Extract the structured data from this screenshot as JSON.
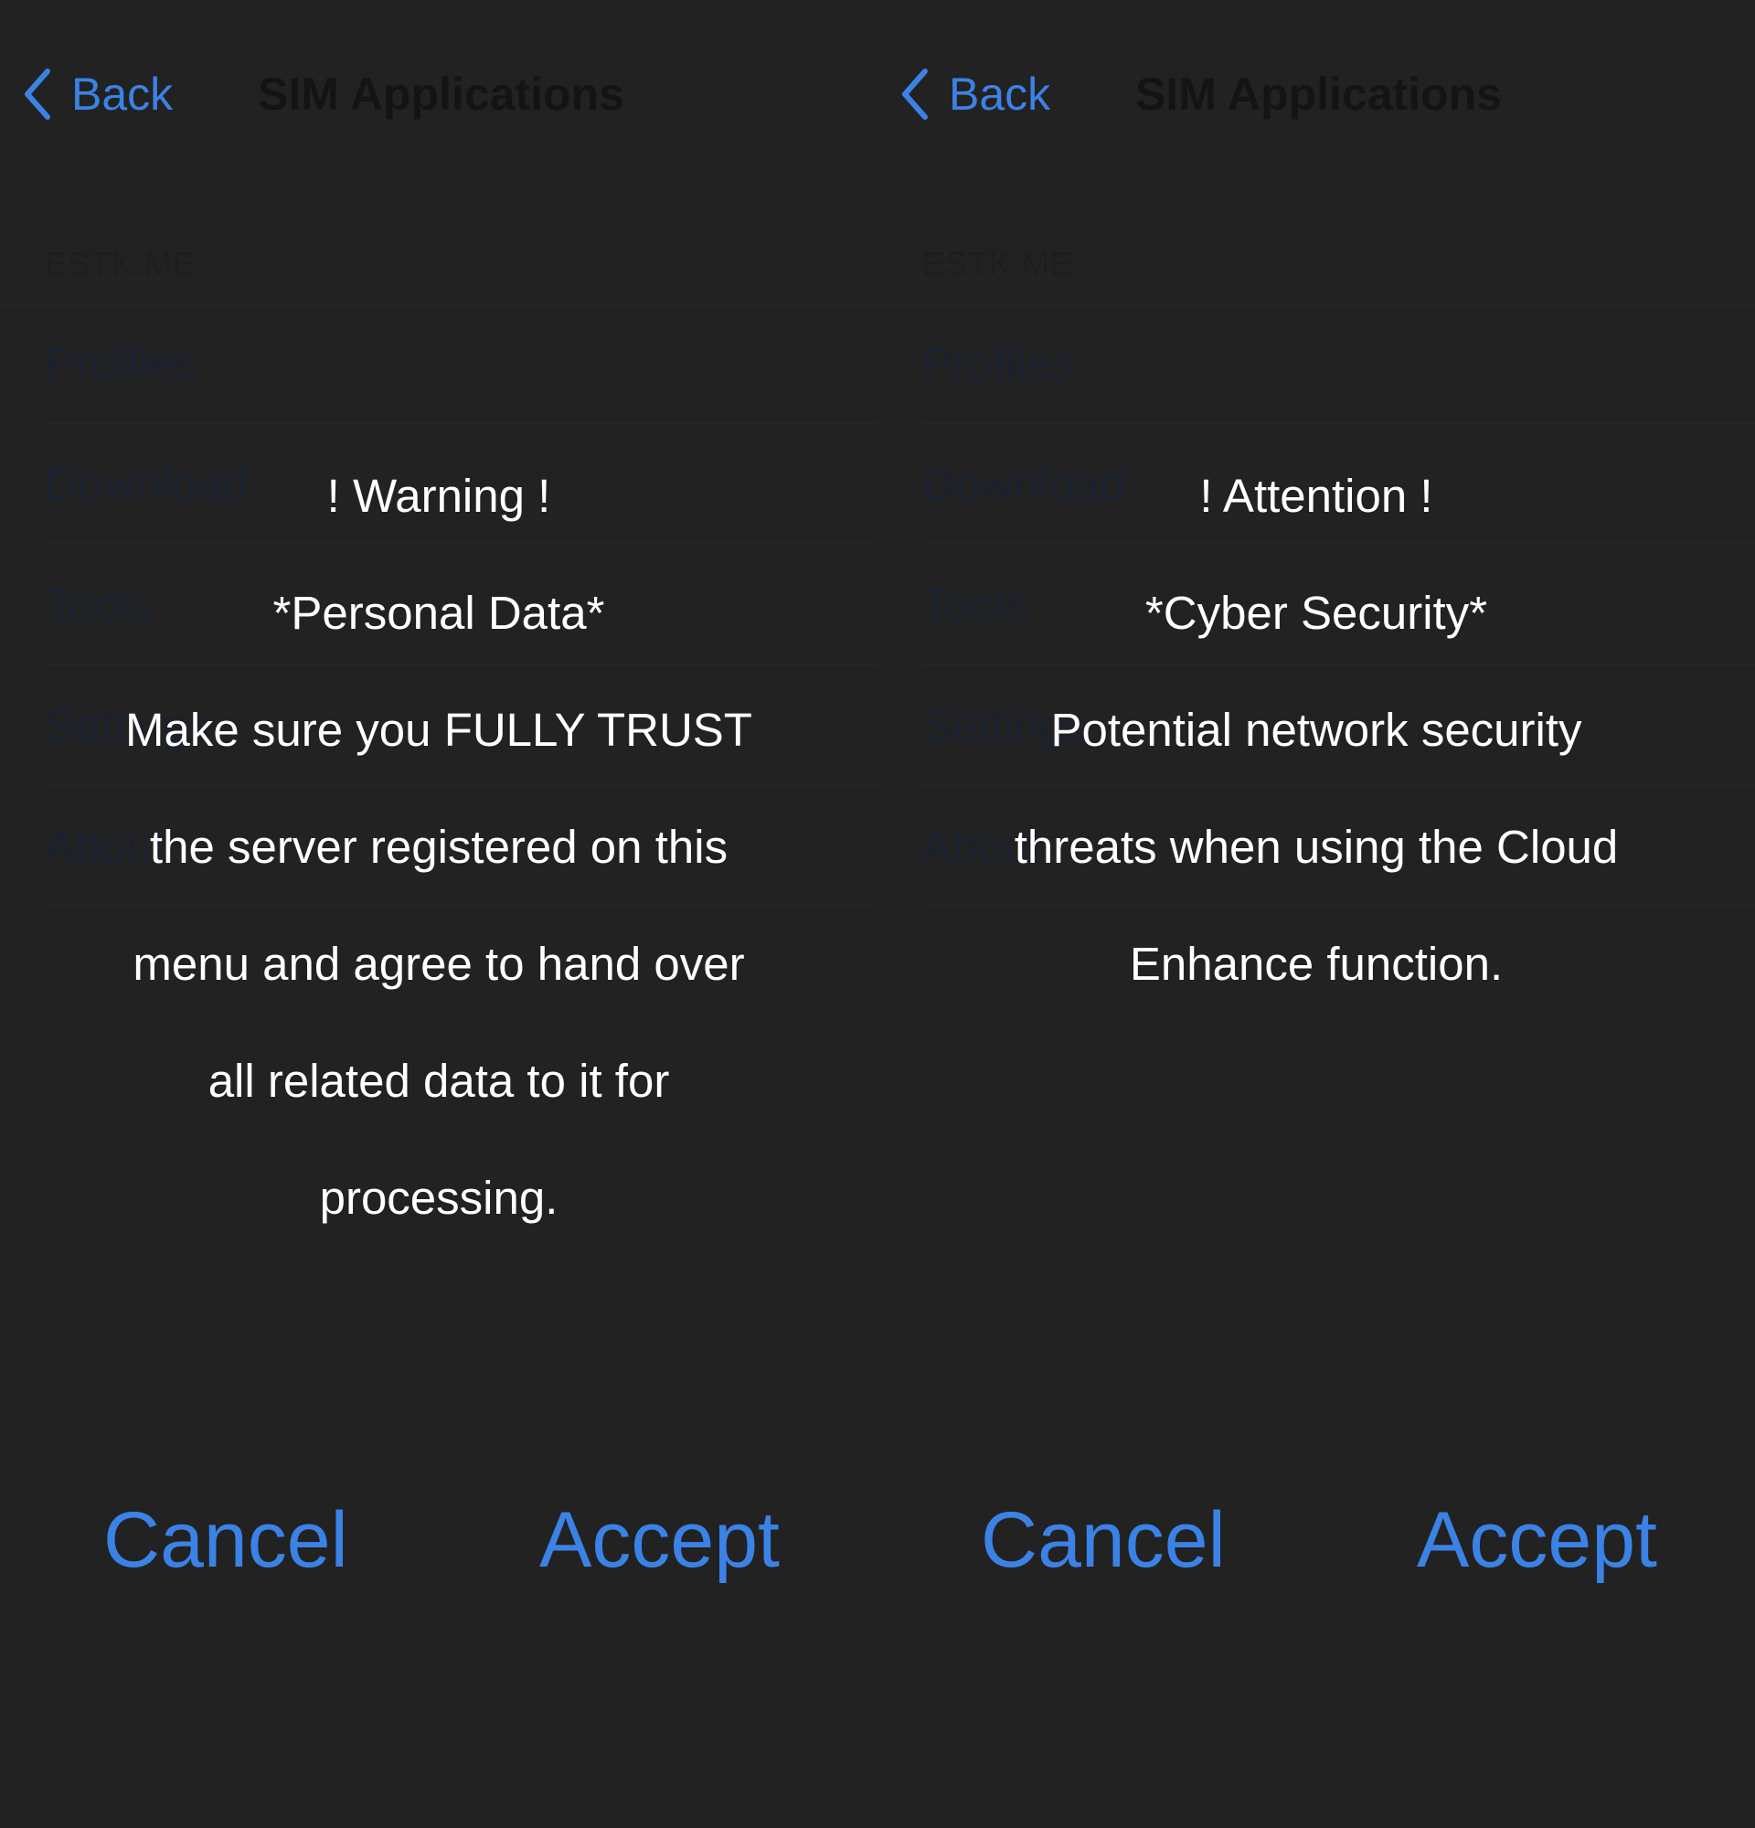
{
  "colors": {
    "background": "#222222",
    "accent": "#3b82e6",
    "message_text": "#ffffff"
  },
  "screens": [
    {
      "nav": {
        "back_label": "Back",
        "title": "SIM Applications",
        "back_icon": "chevron-left-icon"
      },
      "section_header": "ESTK.ME",
      "list_items": [
        "Profiles",
        "Download",
        "Tools",
        "Settings",
        "About"
      ],
      "alert": {
        "lines": [
          "! Warning !",
          "*Personal Data*",
          "Make sure you FULLY TRUST",
          "the server registered on this",
          "menu and agree to hand over",
          "all related data to it for",
          "processing."
        ],
        "cancel_label": "Cancel",
        "accept_label": "Accept"
      }
    },
    {
      "nav": {
        "back_label": "Back",
        "title": "SIM Applications",
        "back_icon": "chevron-left-icon"
      },
      "section_header": "ESTK.ME",
      "list_items": [
        "Profiles",
        "Download",
        "Tools",
        "Settings",
        "About"
      ],
      "alert": {
        "lines": [
          "! Attention !",
          "*Cyber Security*",
          "Potential network security",
          "threats when using the Cloud",
          "Enhance function."
        ],
        "cancel_label": "Cancel",
        "accept_label": "Accept"
      }
    }
  ]
}
